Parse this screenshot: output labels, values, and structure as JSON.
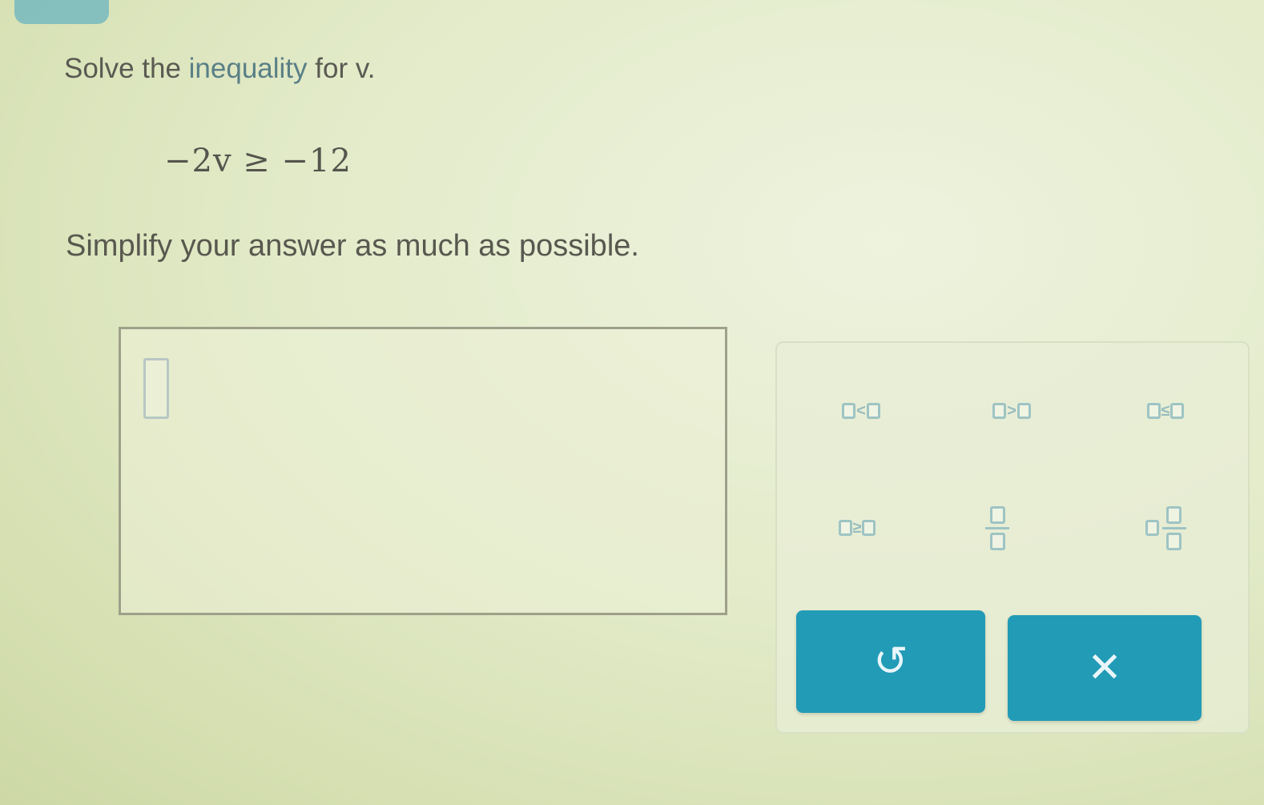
{
  "question": {
    "prompt_before": "Solve the ",
    "prompt_link": "inequality",
    "prompt_after": " for v.",
    "equation": "−2v ≥ −12",
    "instruction": "Simplify your answer as much as possible."
  },
  "keypad": {
    "less_than_symbol": "<",
    "greater_than_symbol": ">",
    "less_equal_symbol": "≤",
    "greater_equal_symbol": "≥",
    "undo_icon": "↺",
    "clear_icon": "✕"
  },
  "colors": {
    "accent": "#229bb6",
    "link_highlight": "#8fc7cf",
    "template_box": "#9ec4c4"
  }
}
